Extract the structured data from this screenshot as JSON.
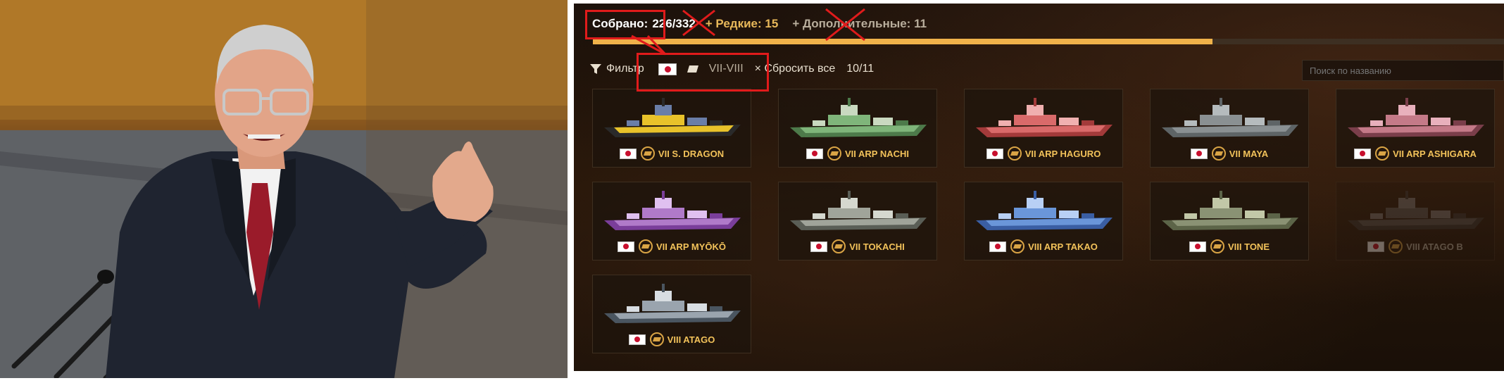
{
  "photo": {
    "description_icon": "speaker-photo"
  },
  "game": {
    "stats": {
      "collected_label": "Собрано:",
      "collected_value": "226/332",
      "rare_label": "+ Редкие: 15",
      "extra_label": "+ Дополнительные: 11",
      "progress_fraction": 0.68
    },
    "filter": {
      "label": "Фильтр",
      "tier_range": "VII-VIII",
      "reset_label": "× Сбросить все",
      "count": "10/11",
      "search_placeholder": "Поиск по названию"
    },
    "ships": [
      {
        "name": "VII S. DRAGON",
        "colors": [
          "#e8c22a",
          "#2a2a2a",
          "#6a7ea8"
        ],
        "collected": true
      },
      {
        "name": "VII ARP NACHI",
        "colors": [
          "#7fb57a",
          "#4d7a4a",
          "#c9d9c0"
        ],
        "collected": true
      },
      {
        "name": "VII ARP HAGURO",
        "colors": [
          "#d96a6a",
          "#a33a3a",
          "#f0b0b0"
        ],
        "collected": true
      },
      {
        "name": "VII MAYA",
        "colors": [
          "#8a9092",
          "#5e6466",
          "#b5bbbd"
        ],
        "collected": true
      },
      {
        "name": "VII ARP ASHIGARA",
        "colors": [
          "#c47a88",
          "#7a3e4a",
          "#e8b0bc"
        ],
        "collected": true
      },
      {
        "name": "VII ARP MYŌKŌ",
        "colors": [
          "#b07ac9",
          "#7a3e9a",
          "#e0c0f0"
        ],
        "collected": true
      },
      {
        "name": "VII TOKACHI",
        "colors": [
          "#a0a49a",
          "#5a5e56",
          "#d5d8cf"
        ],
        "collected": true
      },
      {
        "name": "VIII ARP TAKAO",
        "colors": [
          "#6a96d9",
          "#3a5ea3",
          "#b8d0f5"
        ],
        "collected": true
      },
      {
        "name": "VIII TONE",
        "colors": [
          "#8a9274",
          "#5c6448",
          "#c2c8a8"
        ],
        "collected": true
      },
      {
        "name": "VIII ATAGO B",
        "colors": [
          "#555",
          "#333",
          "#777"
        ],
        "collected": false
      },
      {
        "name": "VIII ATAGO",
        "colors": [
          "#9aa4ae",
          "#4a5560",
          "#d8dde2"
        ],
        "collected": true
      }
    ]
  }
}
